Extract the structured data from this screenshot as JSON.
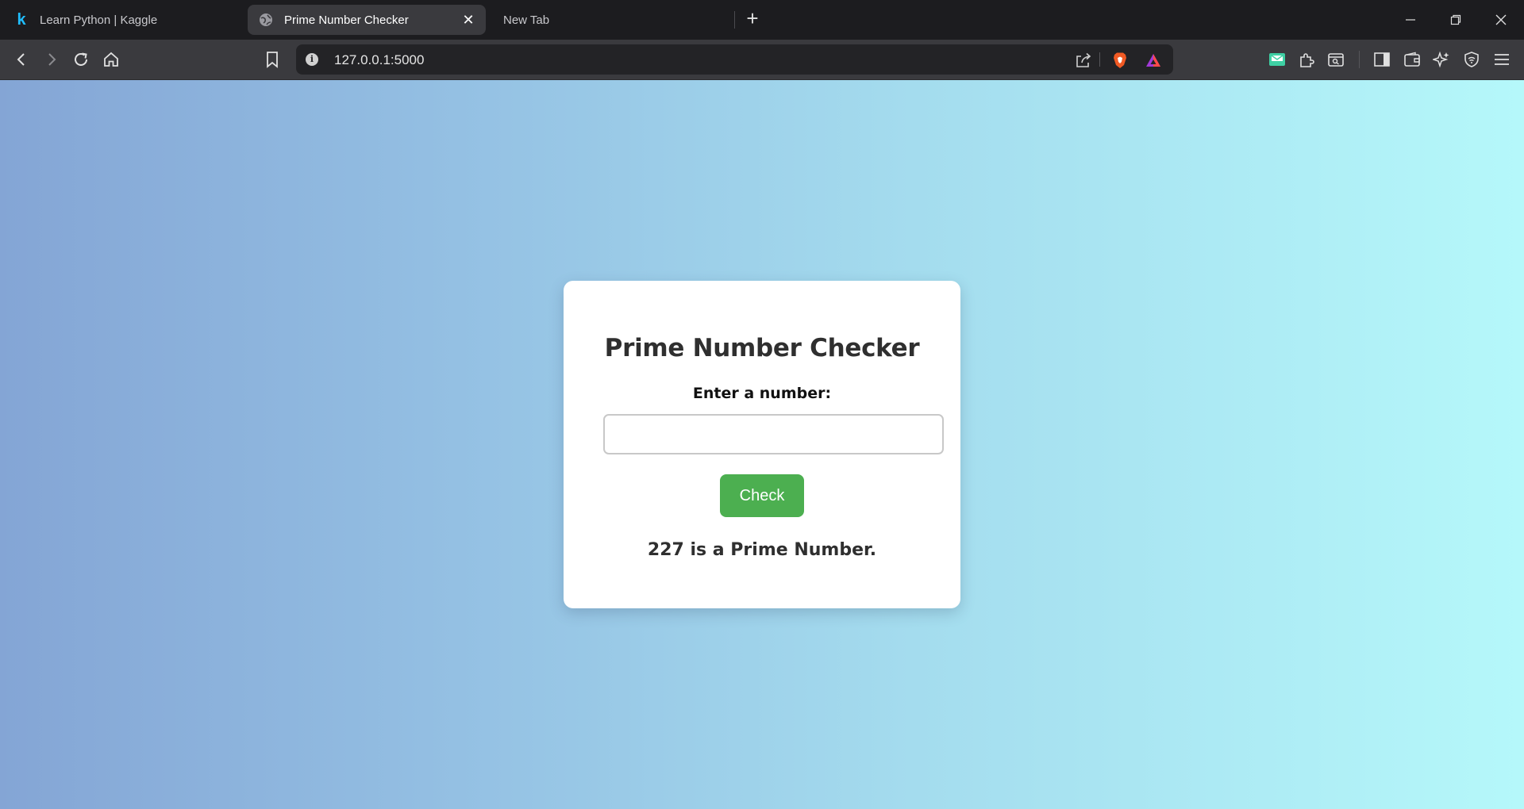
{
  "browser": {
    "tabs": [
      {
        "label": "Learn Python | Kaggle",
        "favicon": "kaggle-logo-icon",
        "active": false
      },
      {
        "label": "Prime Number Checker",
        "favicon": "globe-icon",
        "active": true
      },
      {
        "label": "New Tab",
        "favicon": "",
        "active": false
      }
    ],
    "url": "127.0.0.1:5000",
    "accent_colors": {
      "tabstrip": "#1c1c1f",
      "toolbar": "#3a3a3e",
      "omnibox": "#232326"
    }
  },
  "page": {
    "title": "Prime Number Checker",
    "input_label": "Enter a number:",
    "input_value": "",
    "button_label": "Check",
    "result": "227 is a Prime Number.",
    "colors": {
      "button": "#4caf50",
      "gradient_start": "#84a5d5",
      "gradient_end": "#b5f8fa"
    }
  }
}
